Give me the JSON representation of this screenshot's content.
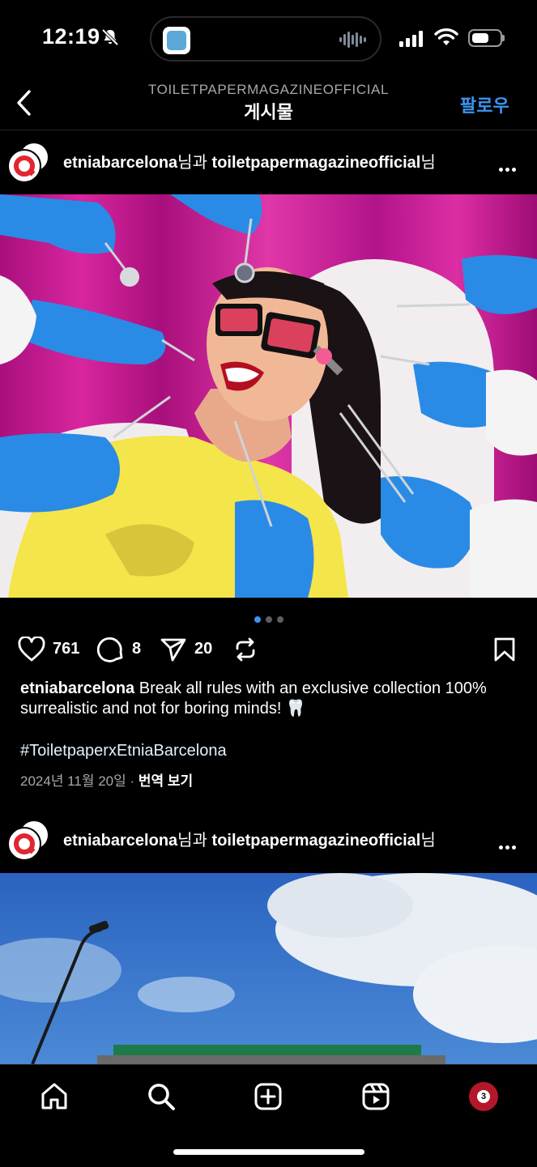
{
  "status_bar": {
    "time": "12:19",
    "icons": [
      "bell-slash-icon",
      "app-icon",
      "audio-wave-icon",
      "cell-signal-icon",
      "wifi-icon",
      "battery-icon"
    ],
    "battery_level": 0.6
  },
  "nav": {
    "account": "TOILETPAPERMAGAZINEOFFICIAL",
    "title": "게시물",
    "follow_label": "팔로우",
    "back_icon": "chevron-left-icon"
  },
  "post": {
    "author_primary": "etniabarcelona",
    "author_suffix1": "님과 ",
    "author_secondary": "toiletpapermagazineofficial",
    "author_suffix2": "님",
    "likes": "761",
    "comments": "8",
    "shares": "20",
    "caption_user": "etniabarcelona",
    "caption_text": " Break all rules with an exclusive collection 100% surrealistic and not for boring minds! 🦷",
    "hashtag": "#ToiletpaperxEtniaBarcelona",
    "date": "2024년 11월 20일",
    "meta_sep": " · ",
    "translate_label": "번역 보기",
    "carousel_count": 3,
    "carousel_active": 0
  },
  "post2": {
    "author_primary": "etniabarcelona",
    "author_suffix1": "님과 ",
    "author_secondary": "toiletpapermagazineofficial",
    "author_suffix2": "님"
  },
  "tab_bar": {
    "items": [
      "home-icon",
      "search-icon",
      "create-icon",
      "reels-icon",
      "profile-avatar"
    ],
    "profile_badge": "3"
  },
  "colors": {
    "accent": "#3b95f0",
    "background": "#000000",
    "brand_red": "#e12630"
  }
}
